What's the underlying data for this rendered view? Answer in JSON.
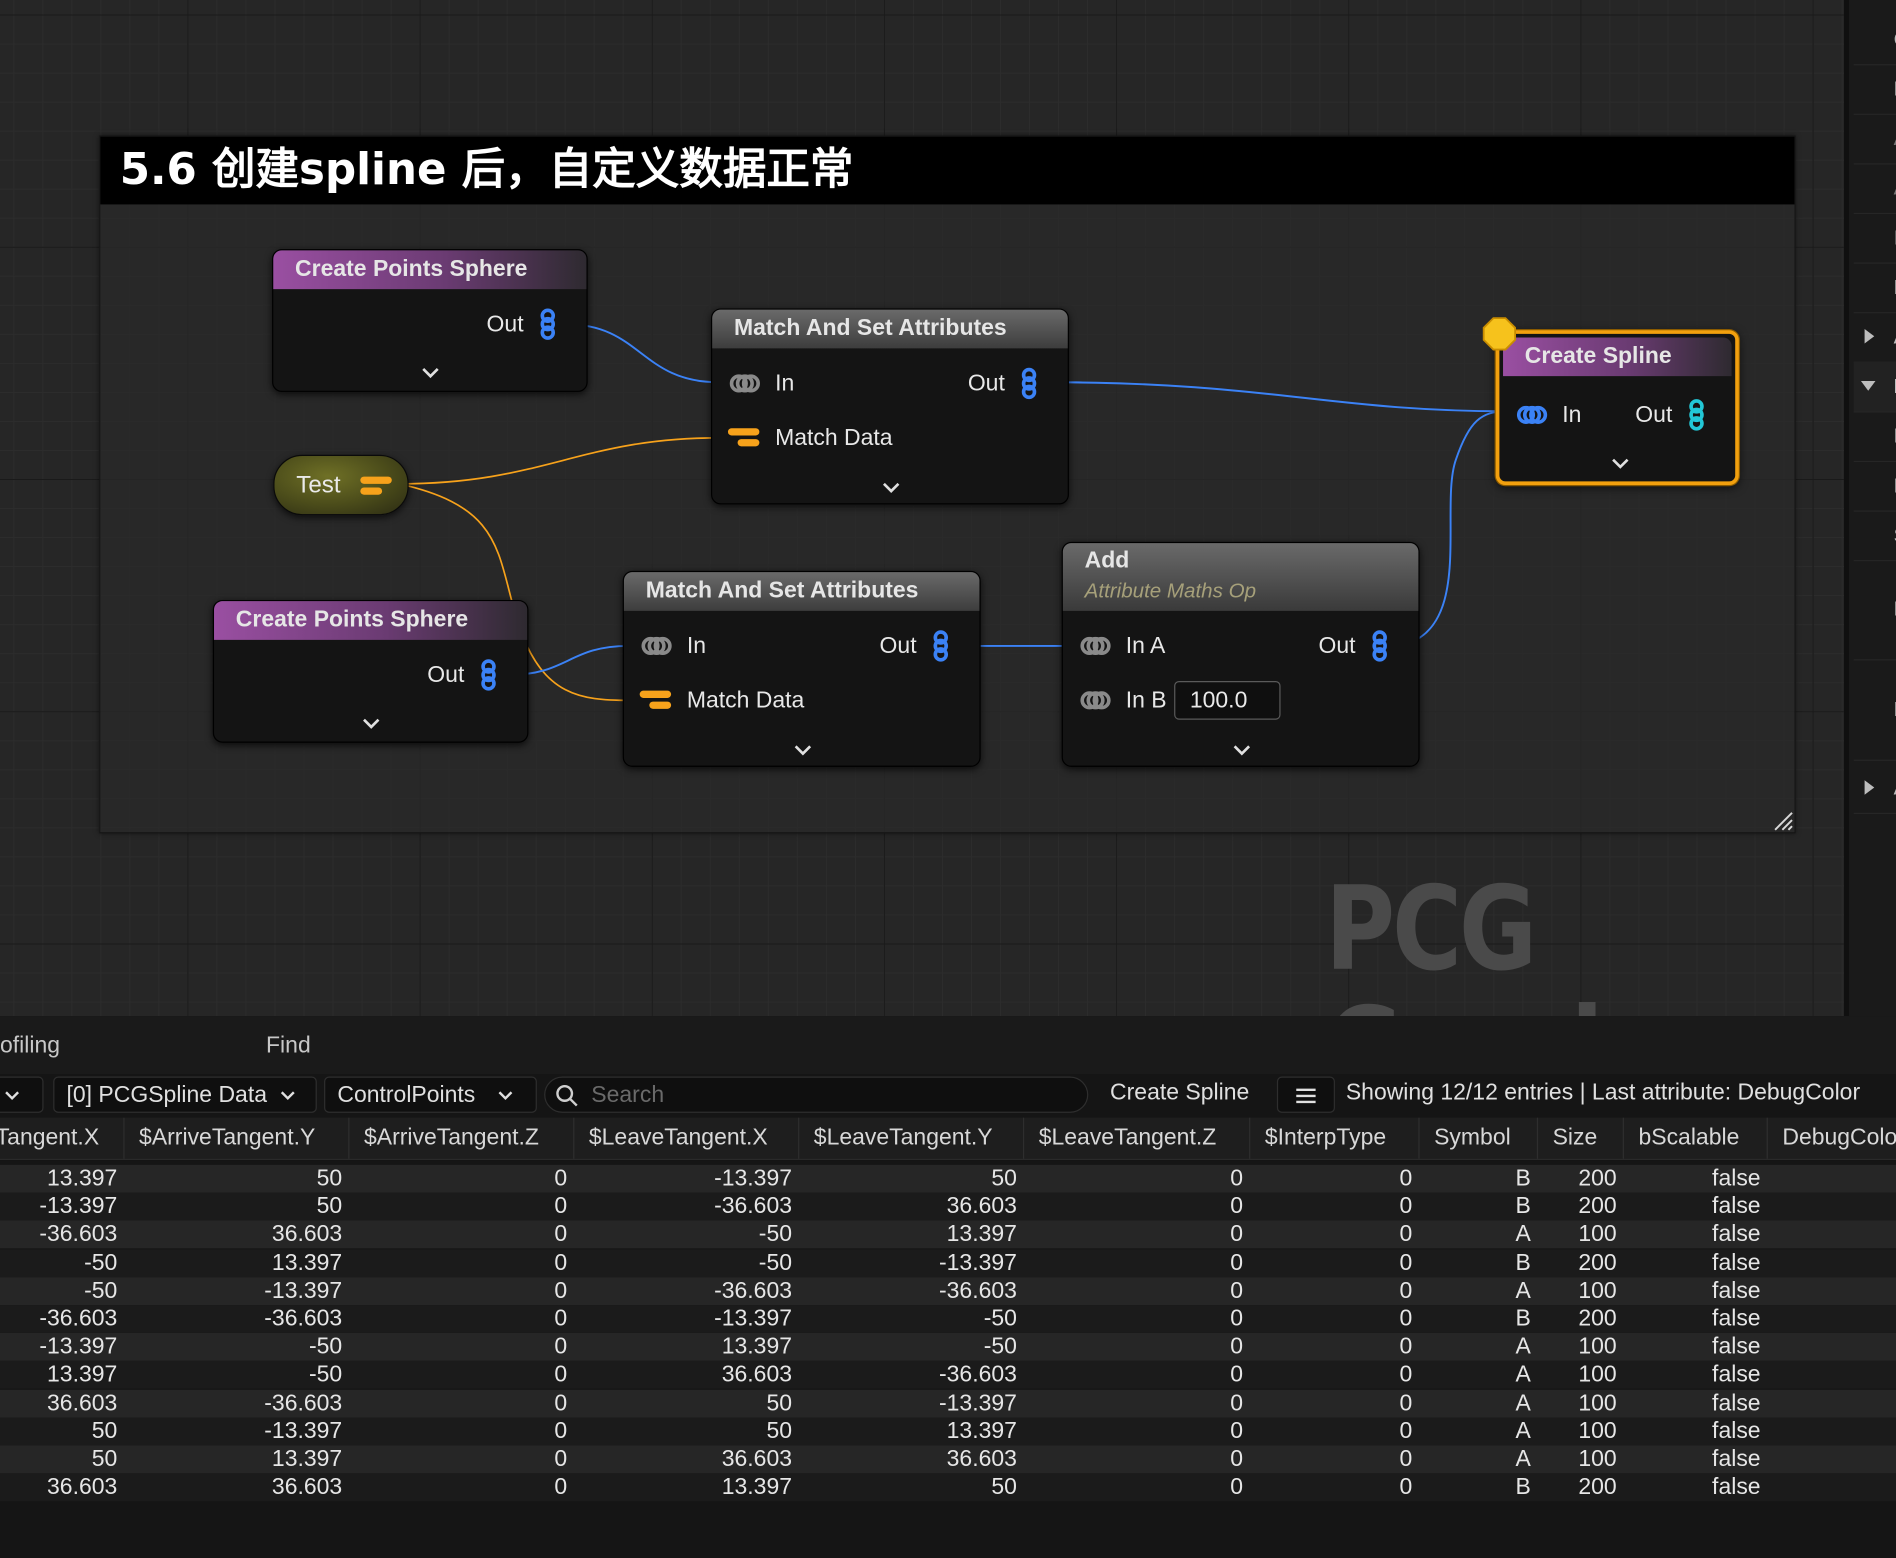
{
  "graph": {
    "comment_title": "5.6 创建spline 后，自定义数据正常",
    "watermark": "PCG Graph",
    "nodes": {
      "sphere1": {
        "title": "Create Points Sphere",
        "out": "Out"
      },
      "sphere2": {
        "title": "Create Points Sphere",
        "out": "Out"
      },
      "test": {
        "label": "Test"
      },
      "match1": {
        "title": "Match And Set Attributes",
        "in": "In",
        "out": "Out",
        "match": "Match Data"
      },
      "match2": {
        "title": "Match And Set Attributes",
        "in": "In",
        "out": "Out",
        "match": "Match Data"
      },
      "add": {
        "title": "Add",
        "subtitle": "Attribute Maths Op",
        "in_a": "In A",
        "in_b": "In B",
        "in_b_value": "100.0",
        "out": "Out"
      },
      "spline": {
        "title": "Create Spline",
        "in": "In",
        "out": "Out"
      }
    },
    "colors": {
      "point_pin": "#3b82f6",
      "param_pin": "#f7a21b",
      "spline_pin": "#22c7d6",
      "selection": "#f2a00e",
      "breakpoint": "#f6c21c"
    }
  },
  "right_panel": {
    "letters": [
      "C",
      "L",
      "A",
      "A",
      "L",
      "F",
      "A",
      "D",
      "E",
      "D",
      "S",
      "F",
      "M",
      "A"
    ]
  },
  "bottom": {
    "tabs": [
      "ofiling",
      "Find"
    ],
    "toolbar": {
      "data_select": "[0] PCGSpline Data",
      "domain_select": "ControlPoints",
      "search_placeholder": "Search",
      "node_name": "Create Spline",
      "status": "Showing 12/12 entries | Last attribute: DebugColor"
    },
    "columns": [
      "Tangent.X",
      "$ArriveTangent.Y",
      "$ArriveTangent.Z",
      "$LeaveTangent.X",
      "$LeaveTangent.Y",
      "$LeaveTangent.Z",
      "$InterpType",
      "Symbol",
      "Size",
      "bScalable",
      "DebugColo"
    ],
    "rows": [
      [
        "13.397",
        "50",
        "0",
        "-13.397",
        "50",
        "0",
        "0",
        "B",
        "200",
        "false"
      ],
      [
        "-13.397",
        "50",
        "0",
        "-36.603",
        "36.603",
        "0",
        "0",
        "B",
        "200",
        "false"
      ],
      [
        "-36.603",
        "36.603",
        "0",
        "-50",
        "13.397",
        "0",
        "0",
        "A",
        "100",
        "false"
      ],
      [
        "-50",
        "13.397",
        "0",
        "-50",
        "-13.397",
        "0",
        "0",
        "B",
        "200",
        "false"
      ],
      [
        "-50",
        "-13.397",
        "0",
        "-36.603",
        "-36.603",
        "0",
        "0",
        "A",
        "100",
        "false"
      ],
      [
        "-36.603",
        "-36.603",
        "0",
        "-13.397",
        "-50",
        "0",
        "0",
        "B",
        "200",
        "false"
      ],
      [
        "-13.397",
        "-50",
        "0",
        "13.397",
        "-50",
        "0",
        "0",
        "A",
        "100",
        "false"
      ],
      [
        "13.397",
        "-50",
        "0",
        "36.603",
        "-36.603",
        "0",
        "0",
        "A",
        "100",
        "false"
      ],
      [
        "36.603",
        "-36.603",
        "0",
        "50",
        "-13.397",
        "0",
        "0",
        "A",
        "100",
        "false"
      ],
      [
        "50",
        "-13.397",
        "0",
        "50",
        "13.397",
        "0",
        "0",
        "A",
        "100",
        "false"
      ],
      [
        "50",
        "13.397",
        "0",
        "36.603",
        "36.603",
        "0",
        "0",
        "A",
        "100",
        "false"
      ],
      [
        "36.603",
        "36.603",
        "0",
        "13.397",
        "50",
        "0",
        "0",
        "B",
        "200",
        "false"
      ]
    ]
  }
}
